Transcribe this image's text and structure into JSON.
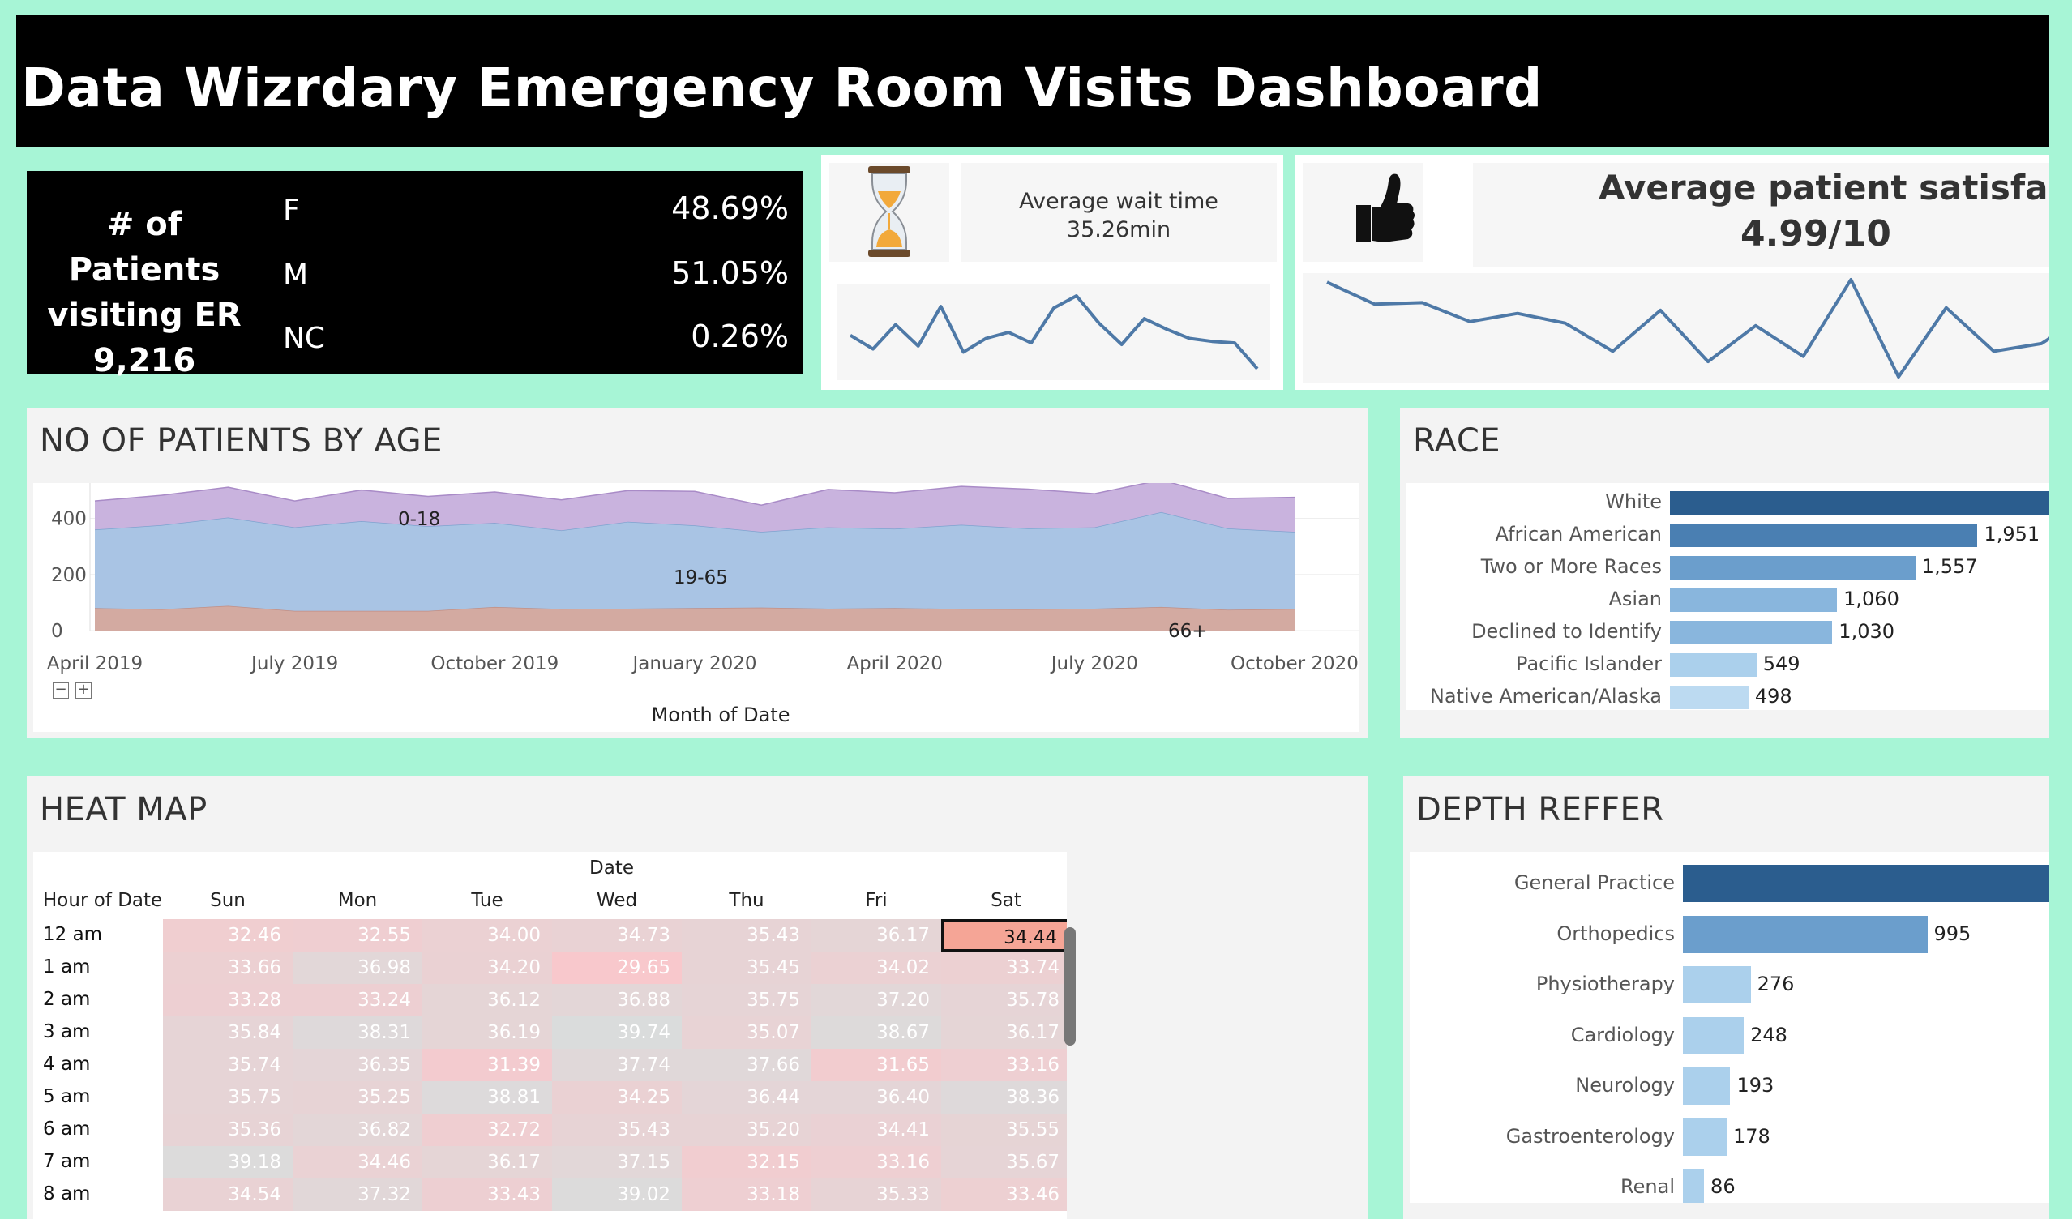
{
  "title": "Data Wizrdary Emergency Room Visits Dashboard",
  "patients": {
    "title_line1": "# of Patients",
    "title_line2": "visiting ER",
    "total": "9,216",
    "genders": [
      {
        "label": "F",
        "value": "48.69%"
      },
      {
        "label": "M",
        "value": "51.05%"
      },
      {
        "label": "NC",
        "value": "0.26%"
      }
    ]
  },
  "wait": {
    "label": "Average wait time",
    "value": "35.26min",
    "icon": "hourglass-icon",
    "trend": [
      35.5,
      34.6,
      36.2,
      34.8,
      37.4,
      34.4,
      35.3,
      35.7,
      35.0,
      37.3,
      38.1,
      36.3,
      34.9,
      36.6,
      35.9,
      35.3,
      35.1,
      35.0,
      33.3
    ]
  },
  "satisfaction": {
    "label": "Average patient satisfaction",
    "value": "4.99/10",
    "icon": "thumbs-up-icon",
    "trend": [
      5.55,
      5.12,
      5.15,
      4.78,
      4.94,
      4.75,
      4.2,
      5.0,
      4.0,
      4.7,
      4.1,
      5.6,
      3.7,
      5.05,
      4.2,
      4.35,
      4.95
    ]
  },
  "age_panel": {
    "title": "NO OF PATIENTS BY AGE",
    "y_ticks": [
      "400",
      "200",
      "0"
    ],
    "x_ticks": [
      "April 2019",
      "July 2019",
      "October 2019",
      "January 2020",
      "April 2020",
      "July 2020",
      "October 2020"
    ],
    "x_title": "Month of Date",
    "labels": {
      "young": "0-18",
      "mid": "19-65",
      "old": "66+"
    },
    "colors": {
      "young": "#c9b3de",
      "mid": "#a9c4e4",
      "old": "#d3aaa1"
    }
  },
  "chart_data": {
    "type": "area",
    "title": "NO OF PATIENTS BY AGE",
    "xlabel": "Month of Date",
    "ylabel": "",
    "ylim": [
      0,
      520
    ],
    "x": [
      "2019-04",
      "2019-05",
      "2019-06",
      "2019-07",
      "2019-08",
      "2019-09",
      "2019-10",
      "2019-11",
      "2019-12",
      "2020-01",
      "2020-02",
      "2020-03",
      "2020-04",
      "2020-05",
      "2020-06",
      "2020-07",
      "2020-08",
      "2020-09",
      "2020-10"
    ],
    "series": [
      {
        "name": "66+",
        "values": [
          80,
          76,
          88,
          70,
          70,
          70,
          84,
          77,
          78,
          80,
          82,
          78,
          80,
          77,
          76,
          78,
          84,
          74,
          77
        ]
      },
      {
        "name": "19-65",
        "values": [
          280,
          300,
          315,
          298,
          320,
          302,
          300,
          280,
          310,
          295,
          270,
          290,
          283,
          300,
          288,
          290,
          338,
          290,
          275
        ]
      },
      {
        "name": "0-18",
        "values": [
          102,
          106,
          108,
          94,
          111,
          106,
          110,
          109,
          111,
          121,
          95,
          135,
          128,
          137,
          140,
          120,
          115,
          107,
          123
        ]
      }
    ]
  },
  "race": {
    "title": "RACE",
    "items": [
      {
        "label": "White",
        "value": 2571,
        "text": ""
      },
      {
        "label": "African American",
        "value": 1951,
        "text": "1,951"
      },
      {
        "label": "Two or More Races",
        "value": 1557,
        "text": "1,557"
      },
      {
        "label": "Asian",
        "value": 1060,
        "text": "1,060"
      },
      {
        "label": "Declined to Identify",
        "value": 1030,
        "text": "1,030"
      },
      {
        "label": "Pacific Islander",
        "value": 549,
        "text": "549"
      },
      {
        "label": "Native American/Alaska N..",
        "value": 498,
        "text": "498"
      }
    ],
    "colors": [
      "#2b5d8e",
      "#4a7fb2",
      "#6b9ecc",
      "#89b6dd",
      "#89b6dd",
      "#abd0ec",
      "#bcdaf1"
    ]
  },
  "heatmap": {
    "title": "HEAT MAP",
    "col_title": "Date",
    "row_title": "Hour of Date",
    "days": [
      "Sun",
      "Mon",
      "Tue",
      "Wed",
      "Thu",
      "Fri",
      "Sat"
    ],
    "hours": [
      "12 am",
      "1 am",
      "2 am",
      "3 am",
      "4 am",
      "5 am",
      "6 am",
      "7 am",
      "8 am"
    ],
    "values": [
      [
        "32.46",
        "32.55",
        "34.00",
        "34.73",
        "35.43",
        "36.17",
        "34.44"
      ],
      [
        "33.66",
        "36.98",
        "34.20",
        "29.65",
        "35.45",
        "34.02",
        "33.74"
      ],
      [
        "33.28",
        "33.24",
        "36.12",
        "36.88",
        "35.75",
        "37.20",
        "35.78"
      ],
      [
        "35.84",
        "38.31",
        "36.19",
        "39.74",
        "35.07",
        "38.67",
        "36.17"
      ],
      [
        "35.74",
        "36.35",
        "31.39",
        "37.74",
        "37.66",
        "31.65",
        "33.16"
      ],
      [
        "35.75",
        "35.25",
        "38.81",
        "34.25",
        "36.44",
        "36.40",
        "38.36"
      ],
      [
        "35.36",
        "36.82",
        "32.72",
        "35.43",
        "35.20",
        "34.41",
        "35.55"
      ],
      [
        "39.18",
        "34.46",
        "36.17",
        "37.15",
        "32.15",
        "33.16",
        "35.67"
      ],
      [
        "34.54",
        "37.32",
        "33.43",
        "39.02",
        "33.18",
        "35.33",
        "33.46"
      ]
    ],
    "highlight": {
      "row": 0,
      "col": 6
    }
  },
  "dept": {
    "title": "DEPTH REFFER",
    "items": [
      {
        "label": "General Practice",
        "value": 1650,
        "text": ""
      },
      {
        "label": "Orthopedics",
        "value": 995,
        "text": "995"
      },
      {
        "label": "Physiotherapy",
        "value": 276,
        "text": "276"
      },
      {
        "label": "Cardiology",
        "value": 248,
        "text": "248"
      },
      {
        "label": "Neurology",
        "value": 193,
        "text": "193"
      },
      {
        "label": "Gastroenterology",
        "value": 178,
        "text": "178"
      },
      {
        "label": "Renal",
        "value": 86,
        "text": "86"
      }
    ],
    "colors": [
      "#2b5d8e",
      "#6b9ecc",
      "#abd0ec",
      "#abd0ec",
      "#abd0ec",
      "#abd0ec",
      "#abd0ec"
    ]
  }
}
